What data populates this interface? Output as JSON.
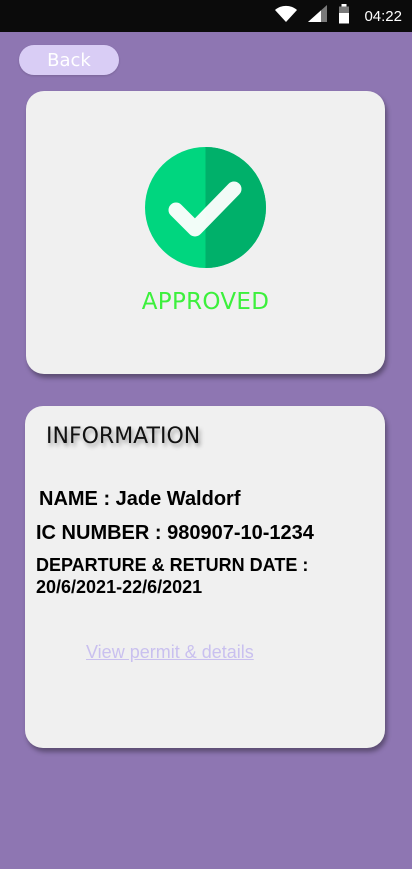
{
  "status_bar": {
    "time": "04:22",
    "icons": [
      "wifi-icon",
      "signal-icon",
      "battery-icon"
    ]
  },
  "nav": {
    "back_label": "Back"
  },
  "status_card": {
    "icon": "check-icon",
    "status_text": "APPROVED",
    "status_color": "#3cf03c",
    "badge_colors": [
      "#00d67f",
      "#00b06a"
    ]
  },
  "info": {
    "title": "INFORMATION",
    "name_line": "NAME : Jade Waldorf",
    "ic_line": "IC NUMBER : 980907-10-1234",
    "date_label": "DEPARTURE & RETURN DATE :",
    "date_value": "20/6/2021-22/6/2021",
    "link_text": "View permit &  details"
  },
  "colors": {
    "background": "#8e76b2",
    "card": "#f0f0f0",
    "back_button": "#d9cdf5"
  }
}
